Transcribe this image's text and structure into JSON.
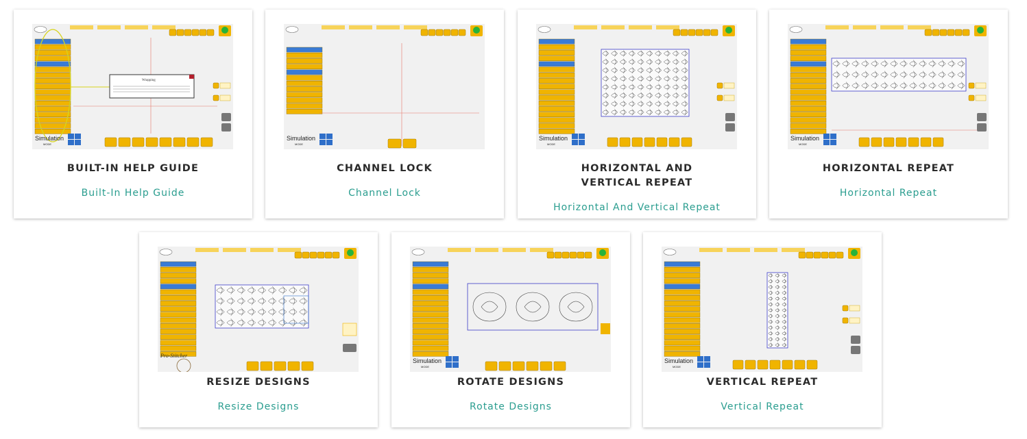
{
  "cards": [
    {
      "title": "BUILT-IN HELP GUIDE",
      "link": "Built-In Help Guide",
      "thumb_variant": "help"
    },
    {
      "title": "CHANNEL LOCK",
      "link": "Channel Lock",
      "thumb_variant": "channel"
    },
    {
      "title": "HORIZONTAL AND VERTICAL REPEAT",
      "link": "Horizontal And Vertical Repeat",
      "thumb_variant": "hv"
    },
    {
      "title": "HORIZONTAL REPEAT",
      "link": "Horizontal Repeat",
      "thumb_variant": "horizontal"
    },
    {
      "title": "RESIZE DESIGNS",
      "link": "Resize Designs",
      "thumb_variant": "resize"
    },
    {
      "title": "ROTATE DESIGNS",
      "link": "Rotate Designs",
      "thumb_variant": "rotate"
    },
    {
      "title": "VERTICAL REPEAT",
      "link": "Vertical Repeat",
      "thumb_variant": "vertical"
    }
  ],
  "thumb_text": {
    "simulation": "Simulation",
    "mode": "MODE",
    "wrapping": "Wrapping",
    "pro_stitcher": "Pro-Stitcher"
  },
  "colors": {
    "link": "#2a9d8f",
    "title": "#2b2b2b",
    "button": "#f0b400",
    "menu_active": "#3a7bd5",
    "guide_line": "#e8786a",
    "pattern_box": "#3b3bc8"
  }
}
